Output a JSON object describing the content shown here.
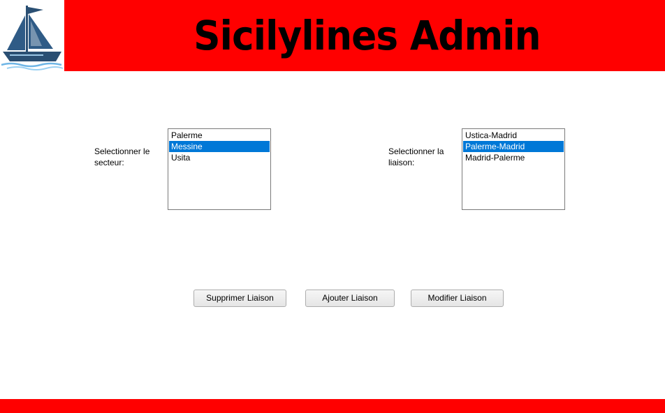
{
  "header": {
    "title": "Sicilylines Admin",
    "background_color": "#ff0000",
    "logo_icon": "sailboat-logo-icon"
  },
  "secteur": {
    "label": "Selectionner le secteur:",
    "items": [
      "Palerme",
      "Messine",
      "Usita"
    ],
    "selected": "Messine"
  },
  "liaison": {
    "label": "Selectionner la liaison:",
    "items": [
      "Ustica-Madrid",
      "Palerme-Madrid",
      "Madrid-Palerme"
    ],
    "selected": "Palerme-Madrid"
  },
  "buttons": {
    "supprimer": "Supprimer Liaison",
    "ajouter": "Ajouter Liaison",
    "modifier": "Modifier Liaison"
  },
  "colors": {
    "accent": "#ff0000",
    "selection": "#0078d7"
  }
}
